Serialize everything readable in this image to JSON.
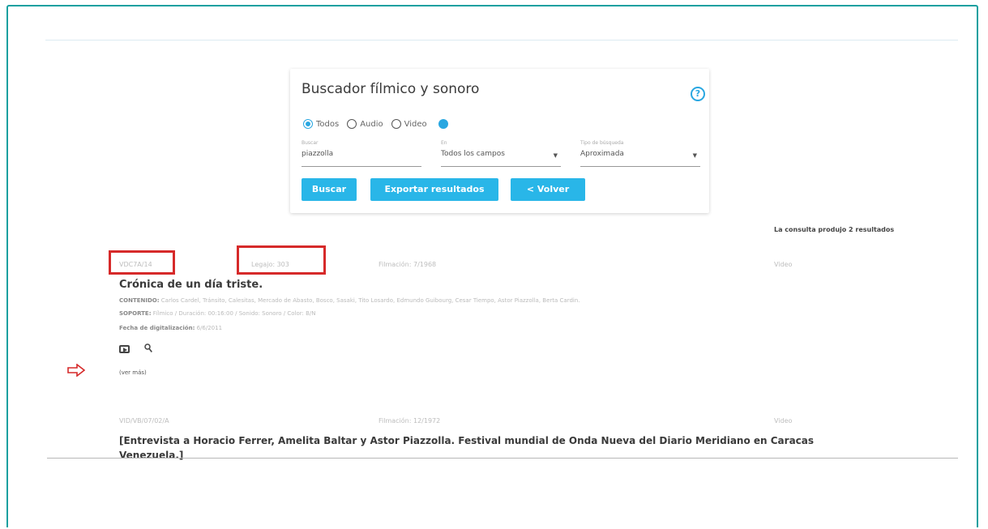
{
  "search": {
    "title": "Buscador fílmico y sonoro",
    "help": "?",
    "radios": [
      {
        "label": "Todos",
        "checked": true
      },
      {
        "label": "Audio",
        "checked": false
      },
      {
        "label": "Video",
        "checked": false
      }
    ],
    "fields": {
      "buscar": {
        "label": "Buscar",
        "value": "piazzolla"
      },
      "en": {
        "label": "En",
        "value": "Todos los campos"
      },
      "tipo": {
        "label": "Tipo de búsqueda",
        "value": "Aproximada"
      }
    },
    "buttons": {
      "buscar": "Buscar",
      "exportar": "Exportar resultados",
      "volver": "< Volver"
    }
  },
  "results_summary": "La consulta produjo 2 resultados",
  "results": [
    {
      "code": "VDC7A/14",
      "legajo": "Legajo: 303",
      "filmacion": "Filmación: 7/1968",
      "type": "Video",
      "title": "Crónica de un día triste.",
      "contenido_label": "CONTENIDO:",
      "contenido": "Carlos Cardel, Tránsito, Calesitas, Mercado de Abasto, Bosco, Sasaki, Tito Losardo, Edmundo Guibourg, Cesar Tiempo, Astor Piazzolla, Berta Cardin.",
      "soporte_label": "SOPORTE:",
      "soporte": "Fílmico / Duración: 00:16:00 / Sonido: Sonoro / Color: B/N",
      "fecha_label": "Fecha de digitalización:",
      "fecha": "6/6/2011",
      "ver_mas": "(ver más)"
    },
    {
      "code": "VID/VB/07/02/A",
      "filmacion": "Filmación: 12/1972",
      "type": "Video",
      "title": "[Entrevista a Horacio Ferrer, Amelita Baltar y Astor Piazzolla. Festival mundial de Onda Nueva del Diario Meridiano en Caracas Venezuela.]"
    }
  ],
  "colors": {
    "frame": "#17a0a0",
    "accent": "#29b6e8",
    "annotation": "#d62a2a"
  }
}
